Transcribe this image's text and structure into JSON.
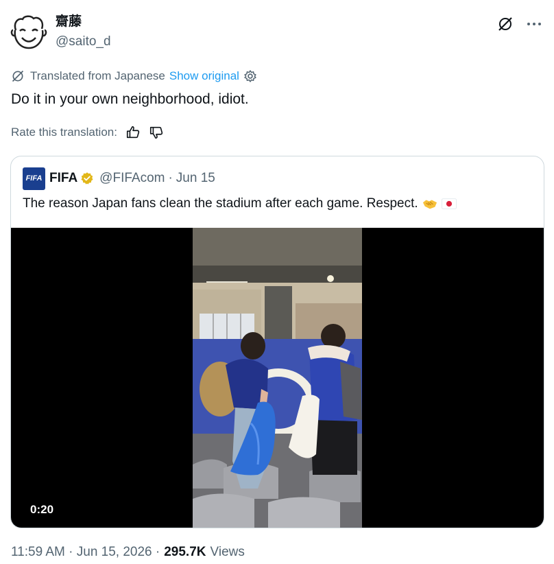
{
  "author": {
    "name": "齋藤",
    "handle": "@saito_d"
  },
  "translation": {
    "translated_from": "Translated from Japanese",
    "show_original": "Show original"
  },
  "tweet": {
    "text": "Do it in your own neighborhood, idiot."
  },
  "rate": {
    "label": "Rate this translation:"
  },
  "quote": {
    "logo_text": "FIFA",
    "name": "FIFA",
    "handle": "@FIFAcom",
    "dot": "·",
    "date": "Jun 15",
    "text": "The reason Japan fans clean the stadium after each game. Respect.",
    "video_duration": "0:20",
    "icons": [
      "verified-badge-icon",
      "handshake-emoji",
      "japan-flag-emoji"
    ]
  },
  "footer": {
    "time_date": "11:59 AM · Jun 15, 2026 ·",
    "views_count": "295.7K",
    "views_label": "Views"
  },
  "colors": {
    "text": "#0f1419",
    "secondary": "#536471",
    "link": "#1d9bf0",
    "border": "#cfd9de",
    "verified": "#e2b719"
  }
}
